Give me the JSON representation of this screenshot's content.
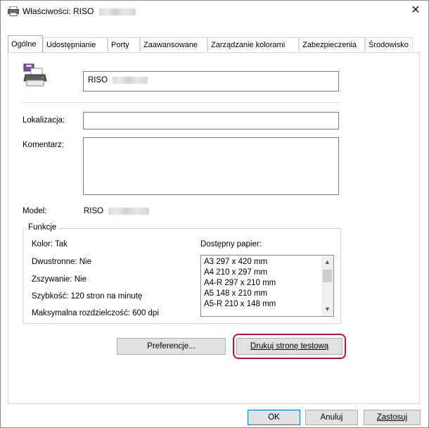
{
  "window": {
    "title": "Właściwości: RISO",
    "close_glyph": "✕"
  },
  "tabs": [
    {
      "label": "Ogólne"
    },
    {
      "label": "Udostępnianie"
    },
    {
      "label": "Porty"
    },
    {
      "label": "Zaawansowane"
    },
    {
      "label": "Zarządzanie kolorami"
    },
    {
      "label": "Zabezpieczenia"
    },
    {
      "label": "Środowisko"
    }
  ],
  "general": {
    "printer_name_value": "RISO",
    "location_label": "Lokalizacja:",
    "location_value": "",
    "comment_label": "Komentarz:",
    "comment_value": "",
    "model_label": "Model:",
    "model_value": "RISO"
  },
  "features": {
    "title": "Funkcje",
    "color": "Kolor: Tak",
    "duplex": "Dwustronne: Nie",
    "staple": "Zszywanie: Nie",
    "speed": "Szybkość: 120 stron na minutę",
    "resolution": "Maksymalna rozdzielczość: 600 dpi",
    "paper_label": "Dostępny papier:",
    "papers": [
      "A3 297 x 420 mm",
      "A4 210 x 297 mm",
      "A4-R 297 x 210 mm",
      "A5 148 x 210 mm",
      "A5-R 210 x 148 mm"
    ]
  },
  "buttons": {
    "preferences": "Preferencje...",
    "print_test": "Drukuj stronę testową",
    "ok": "OK",
    "cancel": "Anuluj",
    "apply": "Zastosuj"
  },
  "colors": {
    "highlight": "#c8102e",
    "focus": "#0078d7"
  }
}
